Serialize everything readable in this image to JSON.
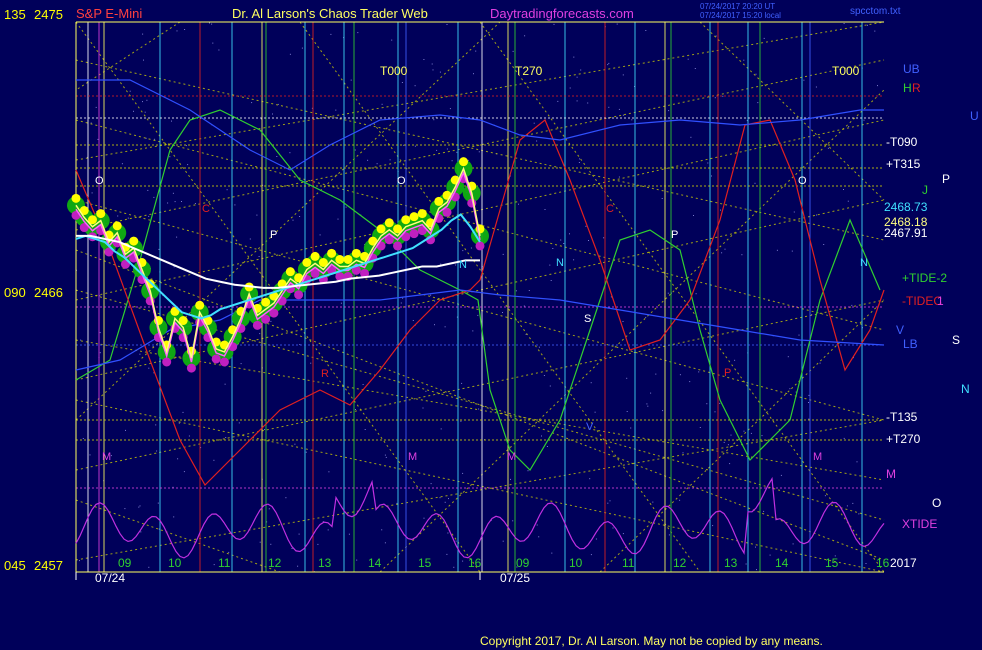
{
  "header": {
    "instrument": "S&P E-Mini",
    "title": "Dr. Al Larson's Chaos Trader Web",
    "site": "Daytradingforecasts.com",
    "stamp1": "07/24/2017 20:20 UT",
    "stamp2": "07/24/2017 15:20 local",
    "file": "spcctom.txt"
  },
  "left_axis": {
    "top_angle": "135",
    "top_price": "2475",
    "mid_angle": "090",
    "mid_price": "2466",
    "bot_angle": "045",
    "bot_price": "2457"
  },
  "right_labels": {
    "ub": "UB",
    "h": "H",
    "r": "R",
    "u": "U",
    "t090": "-T090",
    "t315": "+T315",
    "j": "J",
    "p": "P",
    "price1": "2468.73",
    "price2": "2468.18",
    "price3": "2467.91",
    "tide2": "+TIDE-2",
    "tidec": "-TIDEC",
    "c1": "1",
    "v": "V",
    "lb": "LB",
    "s": "S",
    "n": "N",
    "t135": "-T135",
    "t270": "+T270",
    "m": "M",
    "o": "O",
    "xtide": "XTIDE",
    "year": "2017"
  },
  "top_labels": [
    "T000",
    "T270",
    "T000"
  ],
  "planet_labels": [
    "O",
    "C",
    "P",
    "O",
    "N",
    "N",
    "S",
    "C",
    "P",
    "O",
    "N",
    "R",
    "P",
    "M",
    "M",
    "M",
    "M",
    "V"
  ],
  "hour_labels": [
    "09",
    "10",
    "11",
    "12",
    "13",
    "14",
    "15",
    "16",
    "09",
    "10",
    "11",
    "12",
    "13",
    "14",
    "15",
    "16"
  ],
  "date_labels": [
    "07/24",
    "07/25"
  ],
  "copyright": "Copyright 2017, Dr. Al Larson. May not be copied by any means.",
  "colors": {
    "background": "#00005a",
    "price_up": "#ffff00",
    "price_glow": "#10b010",
    "price_dot": "#c020c0",
    "avg_fast": "#40e0ff",
    "avg_slow": "#ffffff",
    "tide_green": "#30d030",
    "tide_red": "#e02020",
    "xtide": "#c030e0",
    "grid_yellow": "#d8d800"
  },
  "chart_data": {
    "type": "line",
    "title": "S&P E-Mini",
    "ylim": [
      2457,
      2475
    ],
    "price_levels": [
      2468.73,
      2468.18,
      2467.91
    ],
    "series": [
      {
        "name": "price",
        "values": [
          2469.0,
          2468.6,
          2468.3,
          2468.5,
          2467.8,
          2468.1,
          2467.4,
          2467.6,
          2466.9,
          2466.2,
          2465.0,
          2464.2,
          2465.3,
          2465.0,
          2464.0,
          2465.5,
          2465.0,
          2464.3,
          2464.2,
          2464.7,
          2465.3,
          2466.1,
          2465.4,
          2465.6,
          2465.8,
          2466.2,
          2466.6,
          2466.4,
          2466.9,
          2467.1,
          2466.9,
          2467.2,
          2467.0,
          2467.0,
          2467.2,
          2467.1,
          2467.6,
          2468.0,
          2468.2,
          2468.0,
          2468.3,
          2468.4,
          2468.5,
          2468.2,
          2468.9,
          2469.1,
          2469.6,
          2470.2,
          2469.4,
          2468.0
        ]
      },
      {
        "name": "avg_fast",
        "values": [
          2467.9,
          2468.0,
          2467.9,
          2467.8,
          2467.5,
          2467.3,
          2467.0,
          2466.7,
          2466.4,
          2466.1,
          2465.8,
          2465.5,
          2465.4,
          2465.3,
          2465.4,
          2465.6,
          2465.7,
          2465.8,
          2465.9,
          2466.0,
          2466.1,
          2466.2,
          2466.3,
          2466.4,
          2466.5,
          2466.6,
          2466.7,
          2466.8,
          2466.9,
          2467.0,
          2467.1,
          2467.2,
          2467.3,
          2467.4,
          2467.5,
          2467.6,
          2467.8,
          2468.0,
          2468.2,
          2468.5,
          2468.7,
          2468.3,
          2467.8
        ]
      },
      {
        "name": "avg_slow",
        "values": [
          2468.0,
          2468.0,
          2467.9,
          2467.8,
          2467.6,
          2467.4,
          2467.2,
          2467.0,
          2466.8,
          2466.6,
          2466.5,
          2466.4,
          2466.35,
          2466.3,
          2466.3,
          2466.35,
          2466.4,
          2466.45,
          2466.5,
          2466.6,
          2466.65,
          2466.7,
          2466.8,
          2466.9,
          2467.0,
          2467.0,
          2467.1,
          2467.2,
          2467.2
        ]
      }
    ]
  }
}
